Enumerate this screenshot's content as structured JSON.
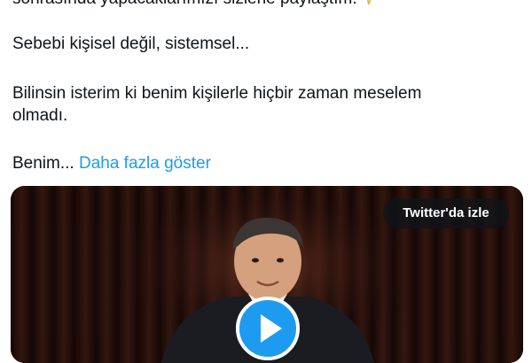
{
  "tweet": {
    "clipped_line": "sonrasında yapacaklarımızı sizlerle paylaştım.",
    "lines": [
      "Sebebi kişisel değil, sistemsel...",
      "Bilinsin isterim ki benim kişilerle hiçbir zaman meselem",
      "olmadı.",
      "Benim..."
    ],
    "show_more": "Daha fazla göster",
    "show_more_color": "#1d9bf0"
  },
  "video": {
    "watch_label": "Twitter'da izle",
    "play_color": "#1d9bf0",
    "icons": {
      "play": "play-icon"
    }
  }
}
